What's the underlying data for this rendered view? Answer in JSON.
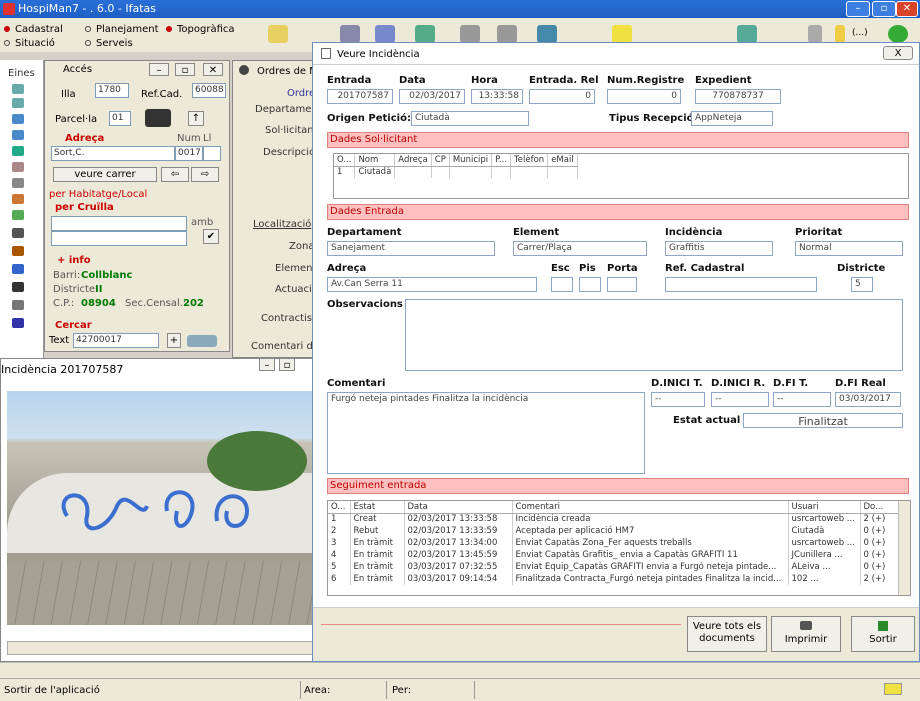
{
  "app": {
    "title": "HospiMan7 - . 6.0 - Ifatas"
  },
  "toolbar": {
    "radio1": "Cadastral",
    "radio2": "Situació",
    "radio3": "Planejament",
    "radio4": "Serveis",
    "radio5": "Topogràfica",
    "num_icon_label": "(...)"
  },
  "strip": {
    "label": "Eines"
  },
  "acces": {
    "title": "Accés",
    "illa_label": "Illa",
    "illa_value": "1780",
    "refcad_label": "Ref.Cad.",
    "refcad_value": "60088",
    "parcela_label": "Parcel·la",
    "parcela_value": "01",
    "adreca_label": "Adreça",
    "num_label": "Num",
    "ll_label": "Ll",
    "street_value": "Sort,C.",
    "street_num": "0017",
    "veure_carrer": "veure carrer",
    "hab_label": "per Habitatge/Local",
    "cruilla_label": "per Cruïlla",
    "amb_label": "amb",
    "info_label": "+ info",
    "barri_label": "Barri:",
    "barri_value": "Collblanc",
    "districte_label": "Districte:",
    "districte_value": "II",
    "cp_label": "C.P.:",
    "cp_value": "08904",
    "seccensal_label": "Sec.Censal.:",
    "seccensal_value": "202",
    "cercar_label": "Cercar",
    "text_label": "Text",
    "text_value": "42700017"
  },
  "ordres": {
    "title": "Ordres de Manteniment",
    "ordre": "Ordre",
    "departament": "Departament",
    "solicitant": "Sol·licitant",
    "descripcio": "Descripció",
    "localitzacio": "Localització",
    "zona": "Zona",
    "element": "Element",
    "actuacio": "Actuació",
    "contractista": "Contractista",
    "comentari": "Comentari de"
  },
  "photo": {
    "title": "Incidència 201707587"
  },
  "dialog": {
    "title": "Veure Incidència",
    "close": "X",
    "entrada_label": "Entrada",
    "entrada_value": "201707587",
    "data_label": "Data",
    "data_value": "02/03/2017",
    "hora_label": "Hora",
    "hora_value": "13:33:58",
    "entrel_label": "Entrada. Rel",
    "entrel_value": "0",
    "numreg_label": "Num.Registre",
    "numreg_value": "0",
    "expedient_label": "Expedient",
    "expedient_value": "770878737",
    "origen_label": "Origen Petició:",
    "origen_value": "Ciutadà",
    "tipus_label": "Tipus Recepció:",
    "tipus_value": "AppNeteja",
    "sol_header": "Dades Sol·licitant",
    "sol_columns": [
      "O...",
      "Nom",
      "Adreça",
      "CP",
      "Municipi",
      "P...",
      "Telèfon",
      "eMail"
    ],
    "sol_rows": [
      [
        "1",
        "Ciutadà",
        "",
        "",
        "",
        "",
        "",
        ""
      ]
    ],
    "ent_header": "Dades Entrada",
    "departament_label": "Departament",
    "departament_value": "Sanejament",
    "element_label": "Element",
    "element_value": "Carrer/Plaça",
    "incidencia_label": "Incidència",
    "incidencia_value": "Graffitis",
    "prioritat_label": "Prioritat",
    "prioritat_value": "Normal",
    "adreca_label": "Adreça",
    "adreca_value": "Av.Can Serra 11",
    "esc_label": "Esc",
    "pis_label": "Pis",
    "porta_label": "Porta",
    "refcad_label": "Ref. Cadastral",
    "districte_label": "Districte",
    "districte_value": "5",
    "observacions_label": "Observacions",
    "comentari_label": "Comentari",
    "comentari_value": "Furgó neteja pintades Finalitza la incidència",
    "dinit_label": "D.INICI T.",
    "dinit_value": "--",
    "dinir_label": "D.INICI R.",
    "dinir_value": "--",
    "dfit_label": "D.FI T.",
    "dfit_value": "--",
    "dfir_label": "D.FI Real",
    "dfir_value": "03/03/2017",
    "estat_label": "Estat actual",
    "estat_value": "Finalitzat",
    "seg_header": "Seguiment entrada",
    "seg_columns": [
      "O...",
      "Estat",
      "Data",
      "Comentari",
      "Usuari",
      "Do..."
    ],
    "seg_rows": [
      [
        "1",
        "Creat",
        "02/03/2017 13:33:58",
        "Incidència creada",
        "usrcartoweb ...",
        "2 (+)"
      ],
      [
        "2",
        "Rebut",
        "02/03/2017 13:33:59",
        "Aceptada per aplicació HM7",
        "Ciutadà",
        "0 (+)"
      ],
      [
        "3",
        "En tràmit",
        "02/03/2017 13:34:00",
        "Enviat Capatàs Zona_Fer aquests treballs",
        "usrcartoweb ...",
        "0 (+)"
      ],
      [
        "4",
        "En tràmit",
        "02/03/2017 13:45:59",
        "Enviat Capatàs Grafitis_ envia a Capatàs GRAFITI 11",
        "JCunillera ...",
        "0 (+)"
      ],
      [
        "5",
        "En tràmit",
        "03/03/2017 07:32:55",
        "Enviat Equip_Capatàs GRAFITI envia a Furgó neteja pintade...",
        "ALeiva ...",
        "0 (+)"
      ],
      [
        "6",
        "En tràmit",
        "03/03/2017 09:14:54",
        "Finalitzada Contracta_Furgó neteja pintades Finalitza la incid...",
        "102 ...",
        "2 (+)"
      ]
    ],
    "btn_docs": "Veure tots els documents",
    "btn_print": "Imprimir",
    "btn_exit": "Sortir"
  },
  "status": {
    "main": "Sortir de l'aplicació",
    "area": "Area:",
    "per": "Per:"
  }
}
